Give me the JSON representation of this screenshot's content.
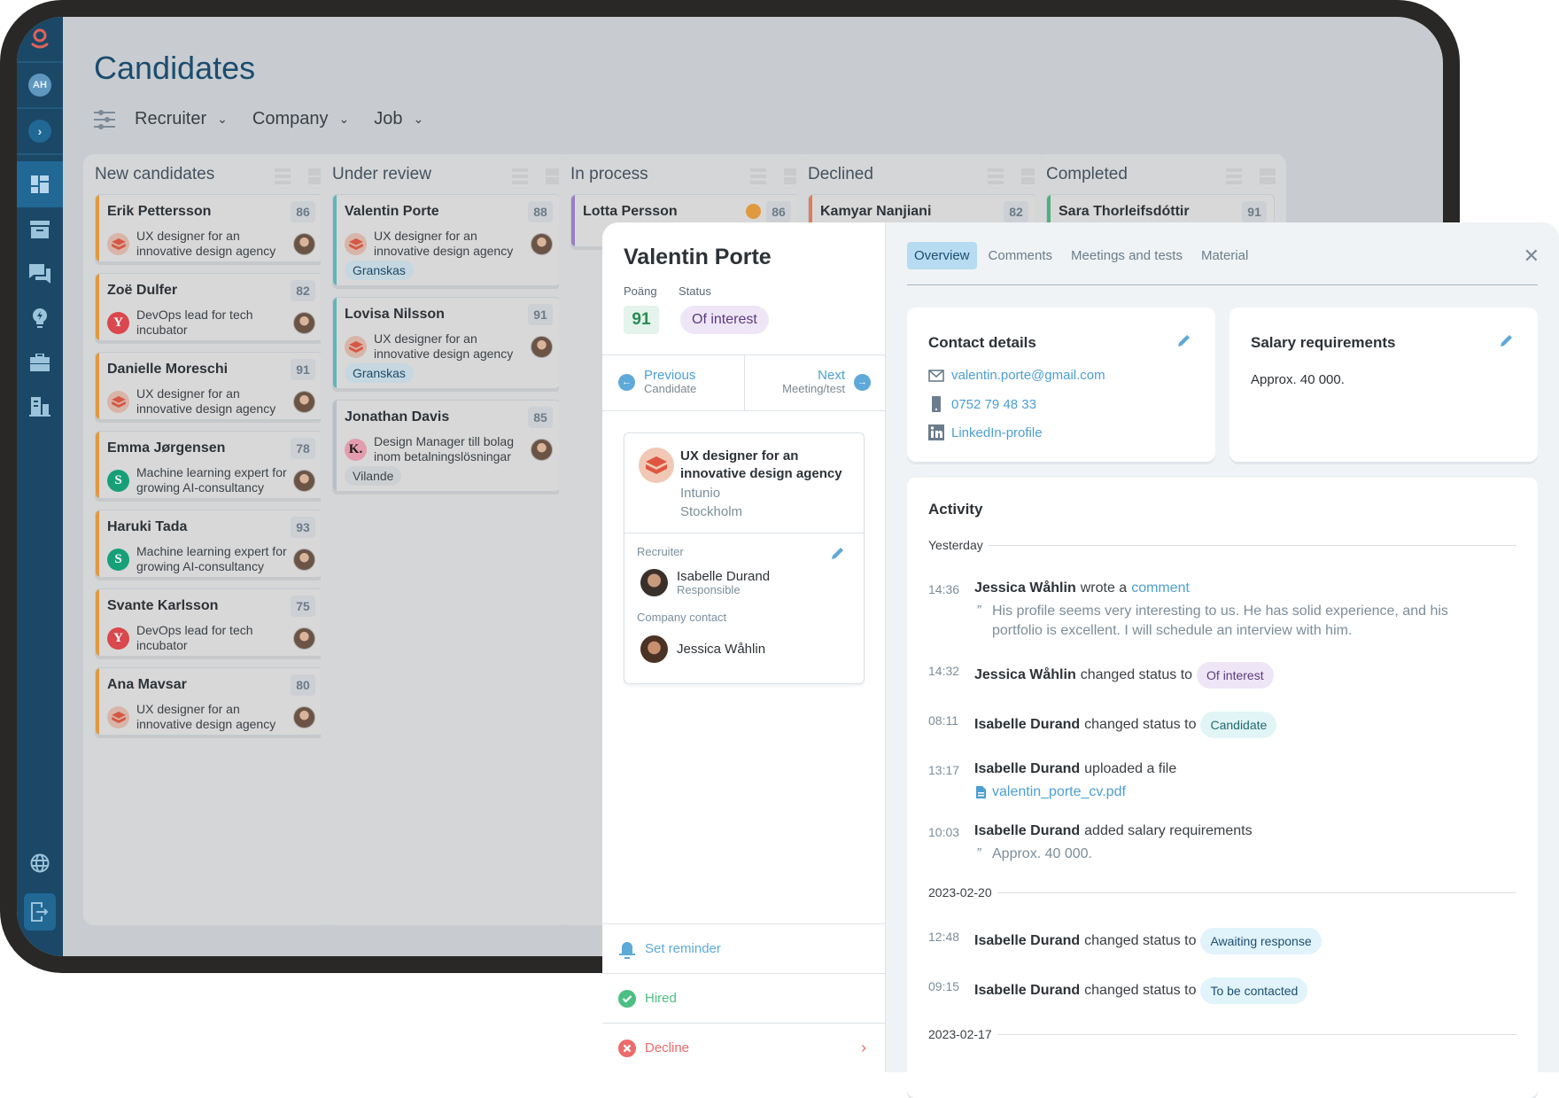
{
  "app": {
    "title": "Candidates",
    "user_initials": "AH",
    "colors": {
      "sidebar": "#1a4866",
      "accent": "#4c9fd1",
      "brand": "#e0625a",
      "title": "#1b4c6e"
    }
  },
  "sidebar": {
    "items": [
      {
        "icon": "dashboard-icon",
        "active": true
      },
      {
        "icon": "archive-icon"
      },
      {
        "icon": "chat-icon"
      },
      {
        "icon": "lightbulb-icon"
      },
      {
        "icon": "briefcase-icon"
      },
      {
        "icon": "building-icon"
      }
    ],
    "bottom": [
      {
        "icon": "globe-icon"
      },
      {
        "icon": "logout-icon"
      }
    ]
  },
  "filters": {
    "icon": "sliders-icon",
    "items": [
      {
        "label": "Recruiter"
      },
      {
        "label": "Company"
      },
      {
        "label": "Job"
      }
    ]
  },
  "columns": [
    {
      "title": "New candidates",
      "color": "#e0993f",
      "cards": [
        {
          "name": "Erik Pettersson",
          "score": "86",
          "job": "UX designer for an innovative design agency",
          "logo": "intunio"
        },
        {
          "name": "Zoë Dulfer",
          "score": "82",
          "job": "DevOps lead for tech incubator",
          "logo": "y"
        },
        {
          "name": "Danielle Moreschi",
          "score": "91",
          "job": "UX designer for an innovative design agency",
          "logo": "intunio"
        },
        {
          "name": "Emma Jørgensen",
          "score": "78",
          "job": "Machine learning expert for growing AI-consultancy",
          "logo": "s"
        },
        {
          "name": "Haruki Tada",
          "score": "93",
          "job": "Machine learning expert for growing AI-consultancy",
          "logo": "s"
        },
        {
          "name": "Svante Karlsson",
          "score": "75",
          "job": "DevOps lead for tech incubator",
          "logo": "y"
        },
        {
          "name": "Ana Mavsar",
          "score": "80",
          "job": "UX designer for an innovative design agency",
          "logo": "intunio"
        }
      ]
    },
    {
      "title": "Under review",
      "color": "#5fb6ba",
      "cards": [
        {
          "name": "Valentin Porte",
          "score": "88",
          "job": "UX designer for an innovative design agency",
          "logo": "intunio",
          "tag": "Granskas"
        },
        {
          "name": "Lovisa Nilsson",
          "score": "91",
          "job": "UX designer for an innovative design agency",
          "logo": "intunio",
          "tag": "Granskas"
        },
        {
          "name": "Jonathan Davis",
          "score": "85",
          "job": "Design Manager till bolag inom betalningslösningar",
          "logo": "k",
          "tag": "Vilande"
        }
      ]
    },
    {
      "title": "In process",
      "color": "#9b7ec4",
      "cards": [
        {
          "name": "Lotta Persson",
          "score": "86"
        }
      ]
    },
    {
      "title": "Declined",
      "color": "#e07a5a",
      "cards": [
        {
          "name": "Kamyar Nanjiani",
          "score": "82"
        }
      ]
    },
    {
      "title": "Completed",
      "color": "#4fb07a",
      "cards": [
        {
          "name": "Sara Thorleifsdóttir",
          "score": "91"
        }
      ]
    }
  ],
  "detail": {
    "name": "Valentin Porte",
    "score_label": "Poäng",
    "score": "91",
    "status_label": "Status",
    "status": "Of interest",
    "previous": {
      "label": "Previous",
      "sub": "Candidate"
    },
    "next": {
      "label": "Next",
      "sub": "Meeting/test"
    },
    "job": {
      "title": "UX designer for an innovative design agency",
      "company": "Intunio",
      "location": "Stockholm"
    },
    "recruiter_label": "Recruiter",
    "recruiter": {
      "name": "Isabelle Durand",
      "role": "Responsible"
    },
    "company_contact_label": "Company contact",
    "company_contact": {
      "name": "Jessica Wåhlin"
    },
    "actions": {
      "reminder": "Set reminder",
      "hired": "Hired",
      "decline": "Decline"
    },
    "tabs": [
      {
        "label": "Overview",
        "active": true
      },
      {
        "label": "Comments"
      },
      {
        "label": "Meetings and tests"
      },
      {
        "label": "Material"
      }
    ],
    "contact": {
      "title": "Contact details",
      "email": "valentin.porte@gmail.com",
      "phone": "0752 79 48 33",
      "linkedin": "LinkedIn-profile"
    },
    "salary": {
      "title": "Salary requirements",
      "value": "Approx. 40 000."
    },
    "activity": {
      "title": "Activity",
      "groups": [
        {
          "day": "Yesterday",
          "events": [
            {
              "time": "14:36",
              "actor": "Jessica Wåhlin",
              "action": "wrote a",
              "link": "comment",
              "quote": "His profile seems very interesting to us. He has solid experience, and his portfolio is excellent. I will schedule an interview with him."
            },
            {
              "time": "14:32",
              "actor": "Jessica Wåhlin",
              "action": "changed status to",
              "pill": "Of interest",
              "pill_color": "#eee6f6",
              "pill_text": "#5d3a80"
            },
            {
              "time": "08:11",
              "actor": "Isabelle Durand",
              "action": "changed status to",
              "pill": "Candidate",
              "pill_color": "#e2f5f6",
              "pill_text": "#1f6b70"
            },
            {
              "time": "13:17",
              "actor": "Isabelle Durand",
              "action": "uploaded a file",
              "file": "valentin_porte_cv.pdf"
            },
            {
              "time": "10:03",
              "actor": "Isabelle Durand",
              "action": "added salary requirements",
              "quote": "Approx. 40 000."
            }
          ]
        },
        {
          "day": "2023-02-20",
          "events": [
            {
              "time": "12:48",
              "actor": "Isabelle Durand",
              "action": "changed status to",
              "pill": "Awaiting response",
              "pill_color": "#e1f3fb",
              "pill_text": "#1d4f72"
            },
            {
              "time": "09:15",
              "actor": "Isabelle Durand",
              "action": "changed status to",
              "pill": "To be contacted",
              "pill_color": "#e1f3fb",
              "pill_text": "#1d4f72"
            }
          ]
        },
        {
          "day": "2023-02-17",
          "events": []
        }
      ]
    }
  }
}
